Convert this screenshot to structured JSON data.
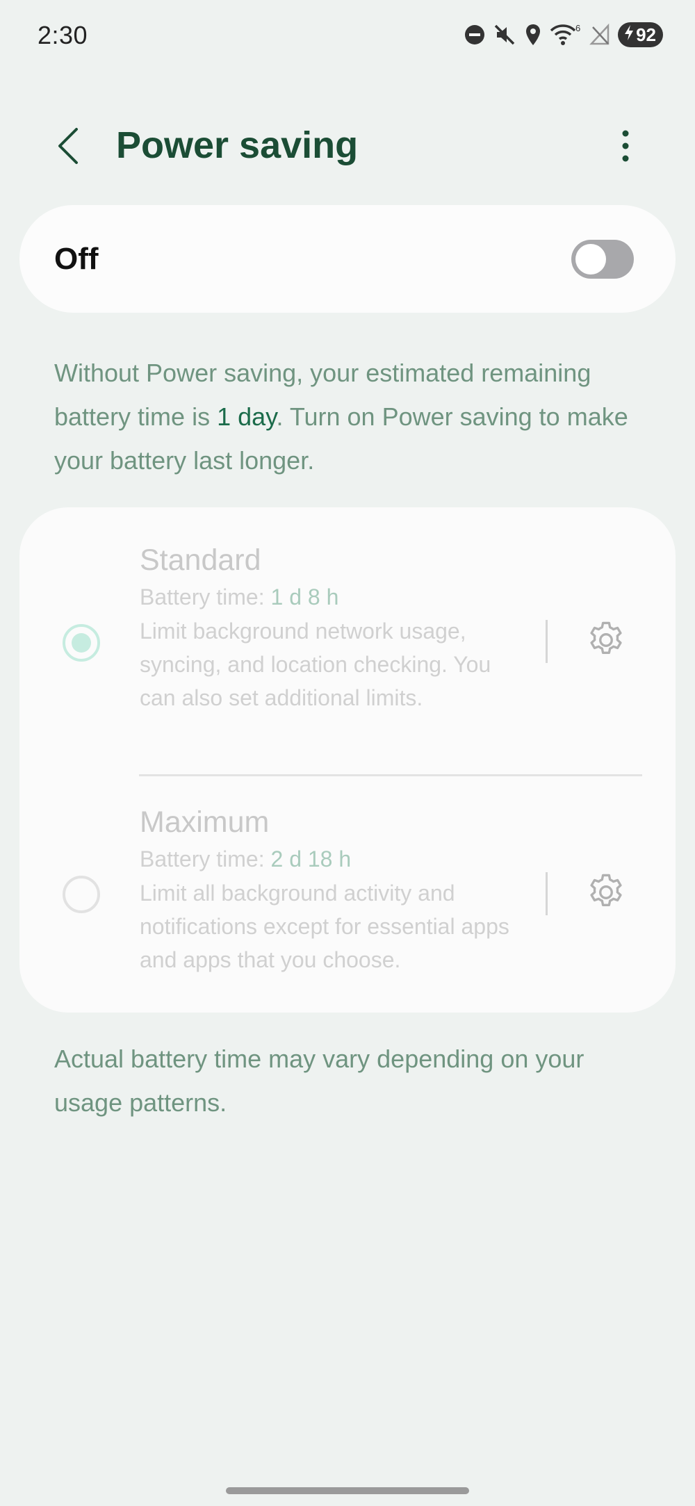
{
  "status_bar": {
    "time": "2:30",
    "battery_level": "92",
    "signal_label": "6",
    "icons": [
      "do-not-disturb-icon",
      "mute-icon",
      "location-icon",
      "wifi-icon",
      "no-signal-icon",
      "battery-charging-icon"
    ]
  },
  "header": {
    "title": "Power saving",
    "back_icon": "chevron-left-icon",
    "more_icon": "more-vertical-icon"
  },
  "power_saving_toggle": {
    "label": "Off",
    "enabled": false
  },
  "description": {
    "part1": "Without Power saving, your estimated remaining battery time is ",
    "highlight": "1 day",
    "part2": ". Turn on Power saving to make your battery last longer."
  },
  "modes": [
    {
      "title": "Standard",
      "battery_time_label": "Battery time: ",
      "battery_time_value": "1 d 8 h",
      "description": "Limit background network usage, syncing, and location checking. You can also set additional limits.",
      "selected": true
    },
    {
      "title": "Maximum",
      "battery_time_label": "Battery time: ",
      "battery_time_value": "2 d 18 h",
      "description": "Limit all background activity and notifications except for essential apps and apps that you choose.",
      "selected": false
    }
  ],
  "footer_note": "Actual battery time may vary depending on your usage patterns.",
  "colors": {
    "background": "#eef2f0",
    "title": "#1b4d35",
    "accent_text": "#6f9480",
    "highlight": "#1b6b4a",
    "switch_off": "#a8a8ab"
  }
}
